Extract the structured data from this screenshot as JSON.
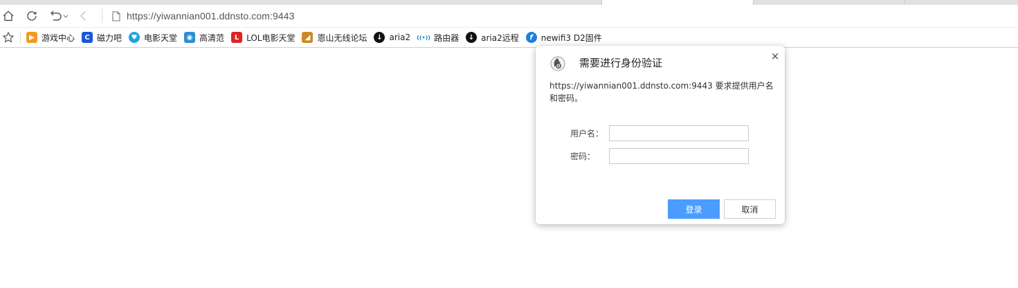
{
  "browser": {
    "address_bar": {
      "url": "https://yiwannian001.ddnsto.com:9443"
    },
    "toolbar": {
      "home_icon": "home-icon",
      "refresh_icon": "refresh-icon",
      "undo_icon": "undo-icon",
      "back_icon": "back-icon",
      "page_icon": "page-icon"
    },
    "bookmarks": [
      {
        "label": "游戏中心",
        "color": "#f39a1e",
        "glyph": "▶"
      },
      {
        "label": "磁力吧",
        "color": "#1a56db",
        "glyph": "C"
      },
      {
        "label": "电影天堂",
        "color": "#1fa3e0",
        "glyph": "♥"
      },
      {
        "label": "高清范",
        "color": "#2b8fd6",
        "glyph": "◉"
      },
      {
        "label": "LOL电影天堂",
        "color": "#e02424",
        "glyph": "L"
      },
      {
        "label": "恩山无线论坛",
        "color": "#c98a2a",
        "glyph": "◢"
      },
      {
        "label": "aria2",
        "color": "#111111",
        "glyph": "↓"
      },
      {
        "label": "路由器",
        "color": "#ffffff",
        "glyph": "((•))"
      },
      {
        "label": "aria2远程",
        "color": "#111111",
        "glyph": "↓"
      },
      {
        "label": "newifi3 D2固件",
        "color": "#1e7fd8",
        "glyph": "f"
      }
    ]
  },
  "dialog": {
    "title": "需要进行身份验证",
    "close_label": "×",
    "message": "https://yiwannian001.ddnsto.com:9443 要求提供用户名和密码。",
    "username_label": "用户名：",
    "password_label": "密码：",
    "username_value": "",
    "password_value": "",
    "login_label": "登录",
    "cancel_label": "取消",
    "accent_color": "#4a9dff"
  }
}
